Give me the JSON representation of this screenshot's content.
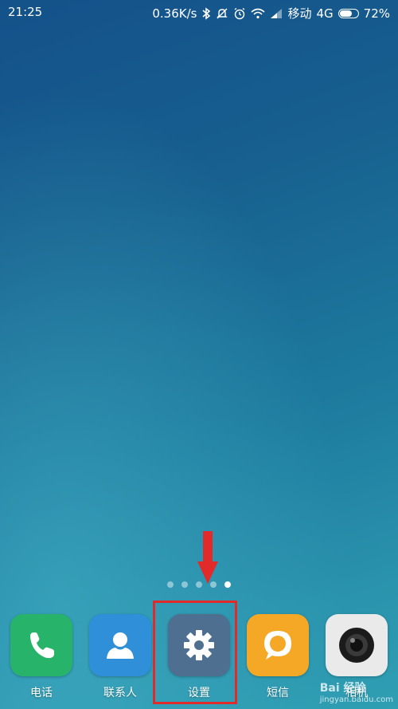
{
  "status_bar": {
    "time": "21:25",
    "network_speed": "0.36K/s",
    "carrier": "移动",
    "network_type": "4G",
    "battery_percent": "72%",
    "battery_level": 0.72,
    "icons": [
      "bluetooth-icon",
      "mute-icon",
      "alarm-icon",
      "wifi-icon",
      "signal-icon",
      "battery-icon"
    ]
  },
  "home": {
    "page_count": 5,
    "active_page_index": 4
  },
  "dock": {
    "apps": [
      {
        "label": "电话",
        "icon": "phone-icon",
        "color": "#27b36a"
      },
      {
        "label": "联系人",
        "icon": "contacts-icon",
        "color": "#2f8fd8"
      },
      {
        "label": "设置",
        "icon": "gear-icon",
        "color": "#4e6f90"
      },
      {
        "label": "短信",
        "icon": "message-icon",
        "color": "#f4a826"
      },
      {
        "label": "相机",
        "icon": "camera-icon",
        "color": "#eaeaea"
      }
    ]
  },
  "annotation": {
    "arrow_color": "#e12a2a",
    "highlight_color": "#e12a2a"
  },
  "watermark": {
    "brand": "Bai 经验",
    "url": "jingyan.baidu.com"
  }
}
